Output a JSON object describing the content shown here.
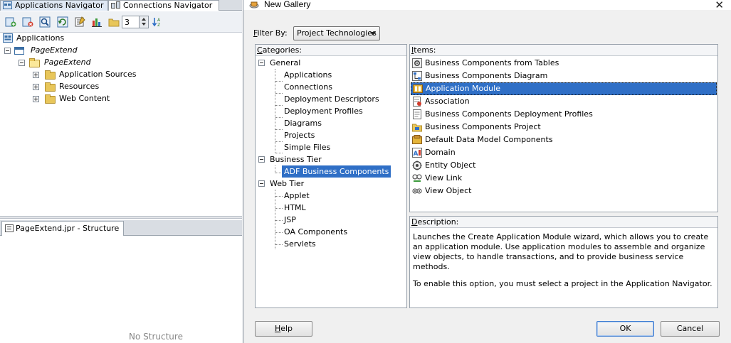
{
  "ide": {
    "tabs": [
      {
        "label": "Applications Navigator",
        "active": true
      },
      {
        "label": "Connections Navigator",
        "active": false
      }
    ],
    "toolbar": {
      "icons": [
        "new-application-icon",
        "delete-icon",
        "find-icon",
        "refresh-icon",
        "properties-icon",
        "chart-icon",
        "folder-icon",
        "sort-icon"
      ],
      "level_value": "3"
    },
    "tree": {
      "root": "Applications",
      "app": "PageExtend",
      "project": "PageExtend",
      "folders": [
        "Application Sources",
        "Resources",
        "Web Content"
      ]
    },
    "structure": {
      "tab_label": "PageExtend.jpr - Structure",
      "empty_text": "No Structure"
    }
  },
  "dialog": {
    "title": "New Gallery",
    "filter": {
      "label_prefix": "F",
      "label_rest": "ilter By:",
      "value": "Project Technologies"
    },
    "categories": {
      "header_prefix": "C",
      "header_rest": "ategories:",
      "general": {
        "label": "General",
        "children": [
          "Applications",
          "Connections",
          "Deployment Descriptors",
          "Deployment Profiles",
          "Diagrams",
          "Projects",
          "Simple Files"
        ]
      },
      "business_tier": {
        "label": "Business Tier",
        "children": [
          "ADF Business Components"
        ],
        "selected": "ADF Business Components"
      },
      "web_tier": {
        "label": "Web Tier",
        "children": [
          "Applet",
          "HTML",
          "JSP",
          "OA Components",
          "Servlets"
        ]
      }
    },
    "items": {
      "header_prefix": "I",
      "header_rest": "tems:",
      "list": [
        {
          "label": "Business Components from Tables",
          "icon": "gear-db-icon"
        },
        {
          "label": "Business Components Diagram",
          "icon": "diagram-icon"
        },
        {
          "label": "Application Module",
          "icon": "app-module-icon"
        },
        {
          "label": "Association",
          "icon": "association-icon"
        },
        {
          "label": "Business Components Deployment Profiles",
          "icon": "deploy-profile-icon"
        },
        {
          "label": "Business Components Project",
          "icon": "project-icon"
        },
        {
          "label": "Default Data Model Components",
          "icon": "data-model-icon"
        },
        {
          "label": "Domain",
          "icon": "domain-icon"
        },
        {
          "label": "Entity Object",
          "icon": "entity-object-icon"
        },
        {
          "label": "View Link",
          "icon": "view-link-icon"
        },
        {
          "label": "View Object",
          "icon": "view-object-icon"
        }
      ],
      "selected": "Application Module"
    },
    "description": {
      "header_prefix": "D",
      "header_rest": "escription:",
      "para1": "Launches the Create Application Module wizard, which allows you to create an application module. Use application modules to assemble and organize view objects, to handle transactions, and to provide business service methods.",
      "para2": "To enable this option, you must select a project in the Application Navigator."
    },
    "buttons": {
      "help_prefix": "H",
      "help_rest": "elp",
      "ok": "OK",
      "cancel": "Cancel"
    },
    "colors": {
      "selection": "#2f6fc6",
      "dialog_bg": "#f0f0f0"
    }
  }
}
